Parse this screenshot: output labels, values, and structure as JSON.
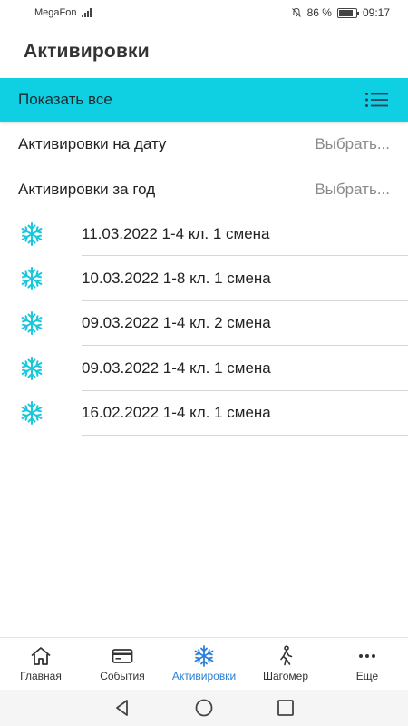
{
  "status_bar": {
    "carrier": "MegaFon",
    "battery": "86 %",
    "time": "09:17"
  },
  "header": {
    "title": "Активировки"
  },
  "show_all": {
    "label": "Показать все",
    "icon": "list-icon"
  },
  "filters": [
    {
      "label": "Активировки на дату",
      "value": "Выбрать..."
    },
    {
      "label": "Активировки за год",
      "value": "Выбрать..."
    }
  ],
  "activations": [
    {
      "text": "11.03.2022 1-4 кл. 1 смена",
      "icon": "snowflake-icon"
    },
    {
      "text": "10.03.2022 1-8 кл. 1 смена",
      "icon": "snowflake-icon"
    },
    {
      "text": "09.03.2022 1-4 кл. 2 смена",
      "icon": "snowflake-icon"
    },
    {
      "text": "09.03.2022 1-4 кл. 1 смена",
      "icon": "snowflake-icon"
    },
    {
      "text": "16.02.2022 1-4 кл. 1 смена",
      "icon": "snowflake-icon"
    }
  ],
  "bottom_nav": [
    {
      "label": "Главная",
      "icon": "home-icon",
      "active": false
    },
    {
      "label": "События",
      "icon": "card-icon",
      "active": false
    },
    {
      "label": "Активировки",
      "icon": "snowflake-icon",
      "active": true
    },
    {
      "label": "Шагомер",
      "icon": "walker-icon",
      "active": false
    },
    {
      "label": "Еще",
      "icon": "more-icon",
      "active": false
    }
  ],
  "colors": {
    "accent": "#0fcfe3",
    "snowflake": "#1cc7dd",
    "active_nav": "#2a7fd6"
  }
}
